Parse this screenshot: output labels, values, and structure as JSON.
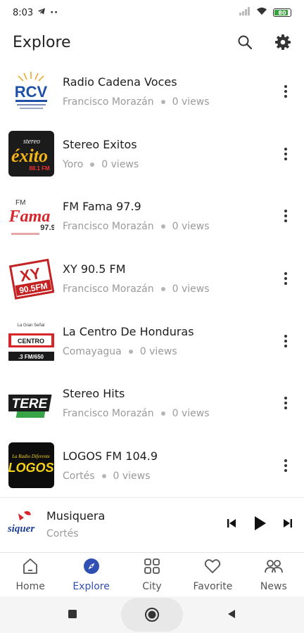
{
  "status_bar": {
    "time": "8:03",
    "dots": "··",
    "battery": "80"
  },
  "app_bar": {
    "title": "Explore"
  },
  "stations": [
    {
      "name": "Radio Cadena Voces",
      "location": "Francisco Morazán",
      "views": "0 views",
      "logo_text": "RCV"
    },
    {
      "name": "Stereo Exitos",
      "location": "Yoro",
      "views": "0 views",
      "logo_text": "éxito"
    },
    {
      "name": "FM Fama 97.9",
      "location": "Francisco Morazán",
      "views": "0 views",
      "logo_text": "Fama"
    },
    {
      "name": "XY 90.5 FM",
      "location": "Francisco Morazán",
      "views": "0 views",
      "logo_text": "XY"
    },
    {
      "name": "La Centro De Honduras",
      "location": "Comayagua",
      "views": "0 views",
      "logo_text": "CENTRO"
    },
    {
      "name": "Stereo Hits",
      "location": "Francisco Morazán",
      "views": "0 views",
      "logo_text": "TERE"
    },
    {
      "name": "LOGOS FM 104.9",
      "location": "Cortés",
      "views": "0 views",
      "logo_text": "LOGOS"
    }
  ],
  "player": {
    "title": "Musiquera",
    "subtitle": "Cortés",
    "logo_text": "siquer"
  },
  "nav": [
    {
      "label": "Home",
      "icon": "home-icon"
    },
    {
      "label": "Explore",
      "icon": "compass-icon",
      "active": true
    },
    {
      "label": "City",
      "icon": "grid-icon"
    },
    {
      "label": "Favorite",
      "icon": "heart-icon"
    },
    {
      "label": "News",
      "icon": "people-icon"
    }
  ],
  "colors": {
    "accent": "#2f4fb3",
    "secondary_text": "#9a9a9a"
  }
}
